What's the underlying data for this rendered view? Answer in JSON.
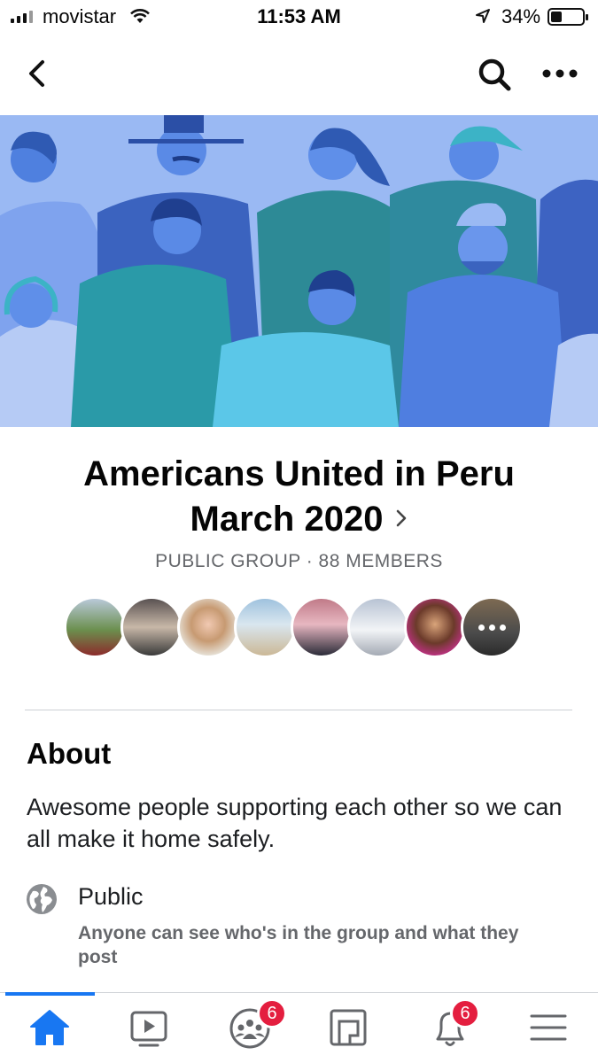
{
  "status_bar": {
    "carrier": "movistar",
    "time": "11:53 AM",
    "battery": "34%",
    "battery_level": 0.34
  },
  "nav": {
    "back_icon": "chevron-left-icon",
    "search_icon": "search-icon",
    "more_icon": "more-horizontal-icon"
  },
  "group": {
    "name_line1": "Americans United in Peru",
    "name_line2": "March 2020",
    "meta": "PUBLIC GROUP · 88 MEMBERS"
  },
  "members": [
    {
      "label": "member-1"
    },
    {
      "label": "member-2"
    },
    {
      "label": "member-3"
    },
    {
      "label": "member-4"
    },
    {
      "label": "member-5"
    },
    {
      "label": "member-6"
    },
    {
      "label": "member-7"
    },
    {
      "label": "member-more"
    }
  ],
  "about": {
    "heading": "About",
    "description": "Awesome people supporting each other so we can all make it home safely.",
    "privacy_title": "Public",
    "privacy_desc": "Anyone can see who's in the group and what they post"
  },
  "tabs": {
    "home_icon": "home-icon",
    "watch_icon": "video-icon",
    "groups_icon": "groups-icon",
    "groups_badge": "6",
    "pages_icon": "pages-icon",
    "notifications_icon": "bell-icon",
    "notifications_badge": "6",
    "menu_icon": "menu-icon"
  },
  "colors": {
    "accent": "#1877f2",
    "badge": "#e41e3f",
    "secondary_text": "#65676b",
    "cover_bg": "#93b6f4"
  }
}
